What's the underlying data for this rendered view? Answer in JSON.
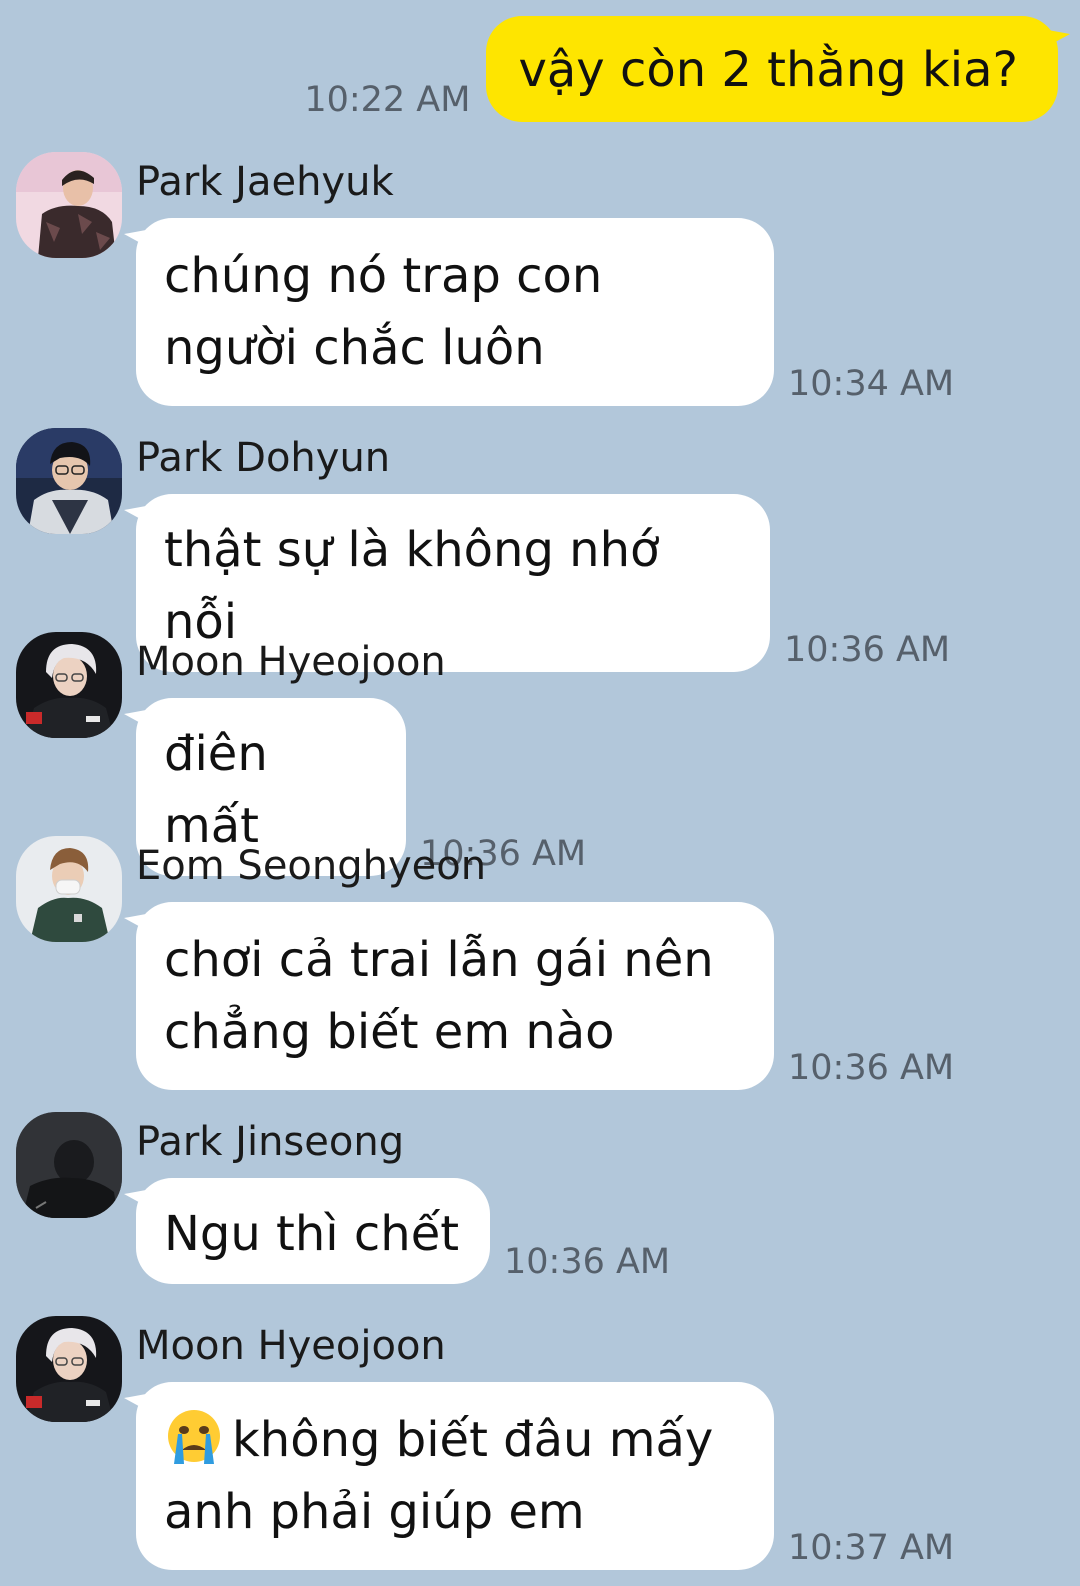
{
  "outgoing": {
    "text": "vậy còn 2 thằng kia?",
    "time": "10:22 AM"
  },
  "messages": [
    {
      "sender": "Park Jaehyuk",
      "avatar": "avatar-park-jaehyuk",
      "lines": [
        "chúng nó trap con",
        "người chắc luôn"
      ],
      "time": "10:34 AM"
    },
    {
      "sender": "Park Dohyun",
      "avatar": "avatar-park-dohyun",
      "lines": [
        "thật sự là không nhớ nỗi"
      ],
      "time": "10:36 AM"
    },
    {
      "sender": "Moon Hyeojoon",
      "avatar": "avatar-moon-hyeojoon",
      "lines": [
        "điên mất"
      ],
      "time": "10:36 AM"
    },
    {
      "sender": "Eom Seonghyeon",
      "avatar": "avatar-eom-seonghyeon",
      "lines": [
        "chơi cả trai lẫn gái nên",
        "chẳng biết em nào"
      ],
      "time": "10:36 AM"
    },
    {
      "sender": "Park Jinseong",
      "avatar": "avatar-park-jinseong",
      "lines": [
        "Ngu thì chết"
      ],
      "time": "10:36 AM"
    },
    {
      "sender": "Moon Hyeojoon",
      "avatar": "avatar-moon-hyeojoon",
      "emoji": "crying-face-emoji",
      "lines": [
        "không biết đâu mấy",
        "anh phải giúp em"
      ],
      "time": "10:37 AM"
    }
  ],
  "colors": {
    "background": "#b2c7da",
    "outgoing_bubble": "#fee500",
    "incoming_bubble": "#ffffff",
    "timestamp": "#56606b"
  }
}
